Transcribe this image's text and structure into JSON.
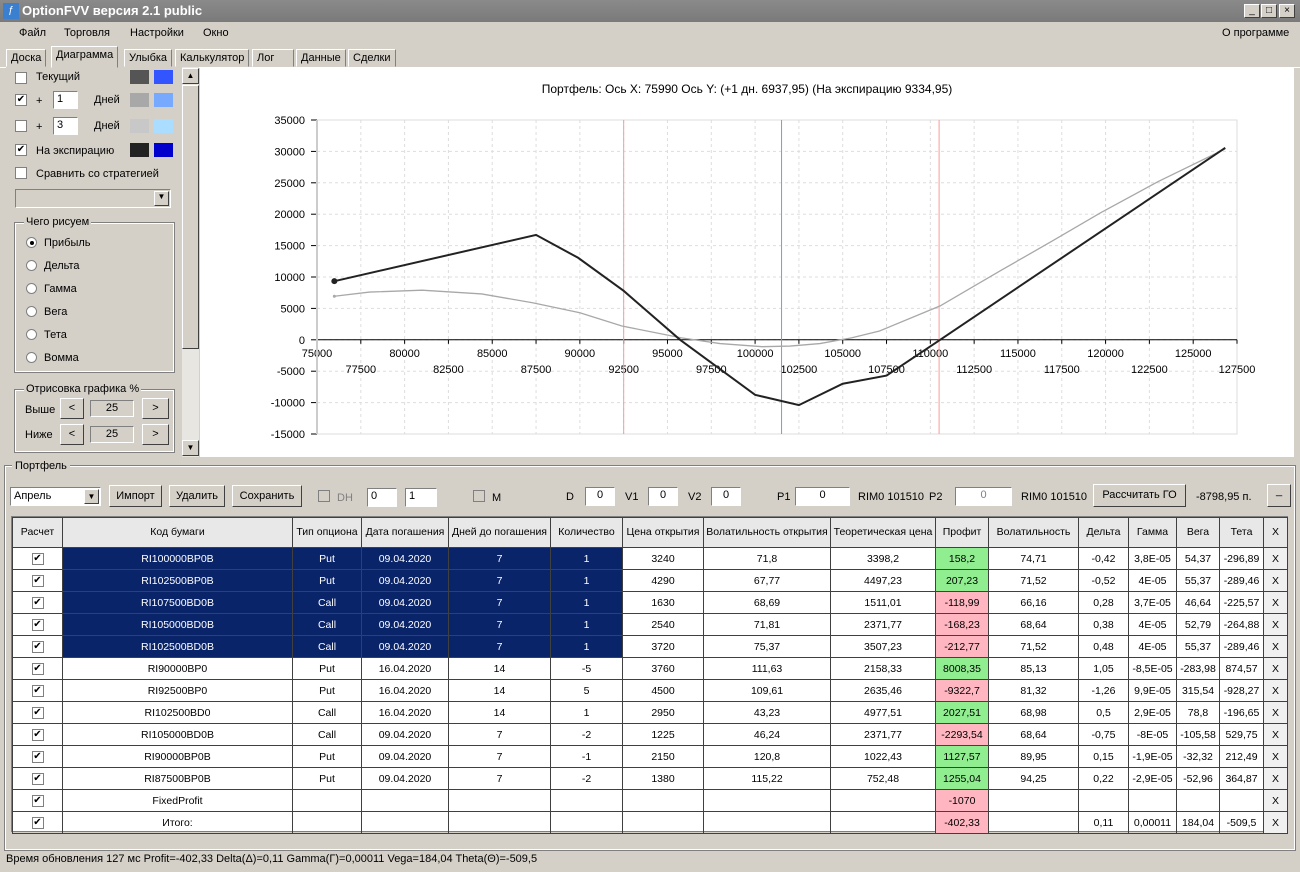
{
  "window": {
    "title": "OptionFVV версия 2.1 public",
    "icon": "app-chart-icon",
    "minimize": "_",
    "maximize": "□",
    "close": "×"
  },
  "menu": {
    "items": [
      "Файл",
      "Торговля",
      "Настройки",
      "Окно"
    ],
    "about": "О программе"
  },
  "tabs": [
    "Доска",
    "Диаграмма",
    "Улыбка",
    "Калькулятор",
    "Лог",
    "Данные",
    "Сделки"
  ],
  "left": {
    "current": {
      "label": "Текущий",
      "checked": false,
      "colors": [
        "#555555",
        "#3355ff"
      ]
    },
    "plus1": {
      "prefix": "+",
      "value": "1",
      "unit": "Дней",
      "checked": true,
      "colors": [
        "#a8a8a8",
        "#77aaff"
      ]
    },
    "plus3": {
      "prefix": "+",
      "value": "3",
      "unit": "Дней",
      "checked": false,
      "colors": [
        "#c8c8c8",
        "#aaddff"
      ]
    },
    "expiry": {
      "label": "На экспирацию",
      "checked": true,
      "colors": [
        "#222222",
        "#0000cc"
      ]
    },
    "compare": {
      "label": "Сравнить со стратегией",
      "checked": false
    },
    "draw_group": {
      "title": "Чего рисуем",
      "options": [
        "Прибыль",
        "Дельта",
        "Гамма",
        "Вега",
        "Тета",
        "Вомма"
      ],
      "selected": 0
    },
    "render_group": {
      "title": "Отрисовка графика %",
      "above_label": "Выше",
      "above": "25",
      "below_label": "Ниже",
      "below": "25",
      "dec": "<",
      "inc": ">"
    }
  },
  "chart_data": {
    "type": "line",
    "title": "Портфель: Ось X: 75990 Ось Y:  (+1 дн. 6937,95)  (На экспирацию 9334,95)",
    "xlim": [
      75000,
      127500
    ],
    "ylim": [
      -15000,
      35000
    ],
    "xticks_top": [
      75000,
      80000,
      85000,
      90000,
      95000,
      100000,
      105000,
      110000,
      115000,
      120000,
      125000
    ],
    "xticks_bottom": [
      77500,
      82500,
      87500,
      92500,
      97500,
      102500,
      107500,
      112500,
      117500,
      122500,
      127500
    ],
    "yticks": [
      35000,
      30000,
      25000,
      20000,
      15000,
      10000,
      5000,
      0,
      -5000,
      -10000,
      -15000
    ],
    "grid": true,
    "series": [
      {
        "name": "+1 дн.",
        "color": "#a8a8a8",
        "x": [
          75990,
          78000,
          81000,
          84400,
          87300,
          90000,
          92400,
          95800,
          98000,
          100400,
          102000,
          103700,
          105500,
          107100,
          110560,
          114000,
          117000,
          119700,
          123000,
          126830
        ],
        "y": [
          6938,
          7600,
          7900,
          7300,
          5900,
          4300,
          2200,
          300,
          -600,
          -1100,
          -1000,
          -600,
          300,
          1400,
          5400,
          11000,
          15800,
          20200,
          25200,
          30400
        ]
      },
      {
        "name": "На экспирацию",
        "color": "#222222",
        "x": [
          75990,
          87500,
          89900,
          92500,
          95720,
          100000,
          102500,
          105000,
          107500,
          110560,
          126830
        ],
        "y": [
          9335,
          16700,
          13060,
          7800,
          0,
          -8760,
          -10400,
          -7000,
          -5700,
          0,
          30570
        ]
      }
    ],
    "vlines": [
      {
        "x": 92500,
        "color": "#ff9999"
      },
      {
        "x": 101510,
        "color": "#8899bb"
      },
      {
        "x": 110500,
        "color": "#ff9999"
      }
    ]
  },
  "portfolio": {
    "title": "Портфель",
    "month": "Апрель",
    "import": "Импорт",
    "delete": "Удалить",
    "save": "Сохранить",
    "dh_label": "DH",
    "spin1": "0",
    "spin2": "1",
    "m_label": "M",
    "d_label": "D",
    "d": "0",
    "v1_label": "V1",
    "v1": "0",
    "v2_label": "V2",
    "v2": "0",
    "p1_label": "P1",
    "p1": "0",
    "inst1": "RIM0 101510",
    "p2_label": "P2",
    "p2": "0",
    "inst2": "RIM0 101510",
    "calc_go": "Рассчитать ГО",
    "go_value": "-8798,95 п.",
    "collapse": "_"
  },
  "table": {
    "headers": [
      "Расчет",
      "Код бумаги",
      "Тип опциона",
      "Дата погашения",
      "Дней до погашения",
      "Количество",
      "Цена открытия",
      "Волатильность открытия",
      "Теоретическая цена",
      "Профит",
      "Волатильность",
      "Дельта",
      "Гамма",
      "Вега",
      "Тета",
      "X"
    ],
    "rows": [
      {
        "sel": true,
        "c": [
          "RI100000BP0B",
          "Put",
          "09.04.2020",
          "7",
          "1",
          "3240",
          "71,8",
          "3398,2",
          "158,2",
          "74,71",
          "-0,42",
          "3,8E-05",
          "54,37",
          "-296,89",
          "X"
        ]
      },
      {
        "sel": true,
        "c": [
          "RI102500BP0B",
          "Put",
          "09.04.2020",
          "7",
          "1",
          "4290",
          "67,77",
          "4497,23",
          "207,23",
          "71,52",
          "-0,52",
          "4E-05",
          "55,37",
          "-289,46",
          "X"
        ]
      },
      {
        "sel": true,
        "c": [
          "RI107500BD0B",
          "Call",
          "09.04.2020",
          "7",
          "1",
          "1630",
          "68,69",
          "1511,01",
          "-118,99",
          "66,16",
          "0,28",
          "3,7E-05",
          "46,64",
          "-225,57",
          "X"
        ]
      },
      {
        "sel": true,
        "c": [
          "RI105000BD0B",
          "Call",
          "09.04.2020",
          "7",
          "1",
          "2540",
          "71,81",
          "2371,77",
          "-168,23",
          "68,64",
          "0,38",
          "4E-05",
          "52,79",
          "-264,88",
          "X"
        ]
      },
      {
        "sel": true,
        "c": [
          "RI102500BD0B",
          "Call",
          "09.04.2020",
          "7",
          "1",
          "3720",
          "75,37",
          "3507,23",
          "-212,77",
          "71,52",
          "0,48",
          "4E-05",
          "55,37",
          "-289,46",
          "X"
        ]
      },
      {
        "sel": false,
        "c": [
          "RI90000BP0",
          "Put",
          "16.04.2020",
          "14",
          "-5",
          "3760",
          "111,63",
          "2158,33",
          "8008,35",
          "85,13",
          "1,05",
          "-8,5E-05",
          "-283,98",
          "874,57",
          "X"
        ]
      },
      {
        "sel": false,
        "c": [
          "RI92500BP0",
          "Put",
          "16.04.2020",
          "14",
          "5",
          "4500",
          "109,61",
          "2635,46",
          "-9322,7",
          "81,32",
          "-1,26",
          "9,9E-05",
          "315,54",
          "-928,27",
          "X"
        ]
      },
      {
        "sel": false,
        "c": [
          "RI102500BD0",
          "Call",
          "16.04.2020",
          "14",
          "1",
          "2950",
          "43,23",
          "4977,51",
          "2027,51",
          "68,98",
          "0,5",
          "2,9E-05",
          "78,8",
          "-196,65",
          "X"
        ]
      },
      {
        "sel": false,
        "c": [
          "RI105000BD0B",
          "Call",
          "09.04.2020",
          "7",
          "-2",
          "1225",
          "46,24",
          "2371,77",
          "-2293,54",
          "68,64",
          "-0,75",
          "-8E-05",
          "-105,58",
          "529,75",
          "X"
        ]
      },
      {
        "sel": false,
        "c": [
          "RI90000BP0B",
          "Put",
          "09.04.2020",
          "7",
          "-1",
          "2150",
          "120,8",
          "1022,43",
          "1127,57",
          "89,95",
          "0,15",
          "-1,9E-05",
          "-32,32",
          "212,49",
          "X"
        ]
      },
      {
        "sel": false,
        "c": [
          "RI87500BP0B",
          "Put",
          "09.04.2020",
          "7",
          "-2",
          "1380",
          "115,22",
          "752,48",
          "1255,04",
          "94,25",
          "0,22",
          "-2,9E-05",
          "-52,96",
          "364,87",
          "X"
        ]
      },
      {
        "sel": false,
        "c": [
          "FixedProfit",
          "",
          "",
          "",
          "",
          "",
          "",
          "",
          "-1070",
          "",
          "",
          "",
          "",
          "",
          "X"
        ]
      },
      {
        "sel": false,
        "c": [
          "Итого:",
          "",
          "",
          "",
          "",
          "",
          "",
          "",
          "-402,33",
          "",
          "0,11",
          "0,00011",
          "184,04",
          "-509,5",
          "X"
        ]
      }
    ]
  },
  "status": "Время обновления 127 мс  Profit=-402,33 Delta(Δ)=0,11 Gamma(Γ)=0,00011 Vega=184,04 Theta(Θ)=-509,5"
}
